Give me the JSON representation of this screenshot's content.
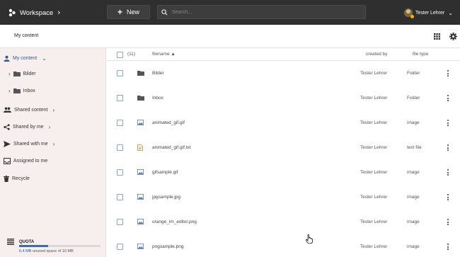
{
  "header": {
    "workspace_label": "Workspace",
    "new_label": "New",
    "search_placeholder": "Search...",
    "user_name": "Tester Lehrer"
  },
  "subheader": {
    "title": "My content"
  },
  "sidebar": {
    "items": [
      {
        "label": "My content",
        "icon": "user-icon"
      },
      {
        "label": "Bilder",
        "icon": "folder-icon"
      },
      {
        "label": "Inbox",
        "icon": "folder-icon"
      },
      {
        "label": "Shared content",
        "icon": "group-icon"
      },
      {
        "label": "Shared by me",
        "icon": "share-icon"
      },
      {
        "label": "Shared with me",
        "icon": "send-icon"
      },
      {
        "label": "Assigned to me",
        "icon": "inbox-icon"
      },
      {
        "label": "Recycle",
        "icon": "trash-icon"
      }
    ],
    "quota": {
      "title": "QUOTA",
      "used": "6.4 MB",
      "text": " unused space of 10 MB",
      "fraction_used": 0.36
    }
  },
  "table": {
    "count": "(11)",
    "columns": {
      "filename": "filename",
      "created_by": "created by",
      "file_type": "file type"
    },
    "rows": [
      {
        "name": "Bilder",
        "created_by": "Tester Lehrer",
        "type": "Folder",
        "icon": "folder-icon"
      },
      {
        "name": "Inbox",
        "created_by": "Tester Lehrer",
        "type": "Folder",
        "icon": "folder-icon"
      },
      {
        "name": "animated_gif.gif",
        "created_by": "Tester Lehrer",
        "type": "image",
        "icon": "image-icon"
      },
      {
        "name": "animated_gif.gif.txt",
        "created_by": "Tester Lehrer",
        "type": "text file",
        "icon": "text-file-icon"
      },
      {
        "name": "gifsample.gif",
        "created_by": "Tester Lehrer",
        "type": "image",
        "icon": "image-icon"
      },
      {
        "name": "jpgsample.jpg",
        "created_by": "Tester Lehrer",
        "type": "image",
        "icon": "image-icon"
      },
      {
        "name": "orange_im_editor.png",
        "created_by": "Tester Lehrer",
        "type": "image",
        "icon": "image-icon"
      },
      {
        "name": "pngsample.png",
        "created_by": "Tester Lehrer",
        "type": "image",
        "icon": "image-icon"
      }
    ]
  },
  "colors": {
    "topbar": "#2f2f2f",
    "sidebar": "#f7eeee",
    "accent": "#2a5a9a"
  }
}
